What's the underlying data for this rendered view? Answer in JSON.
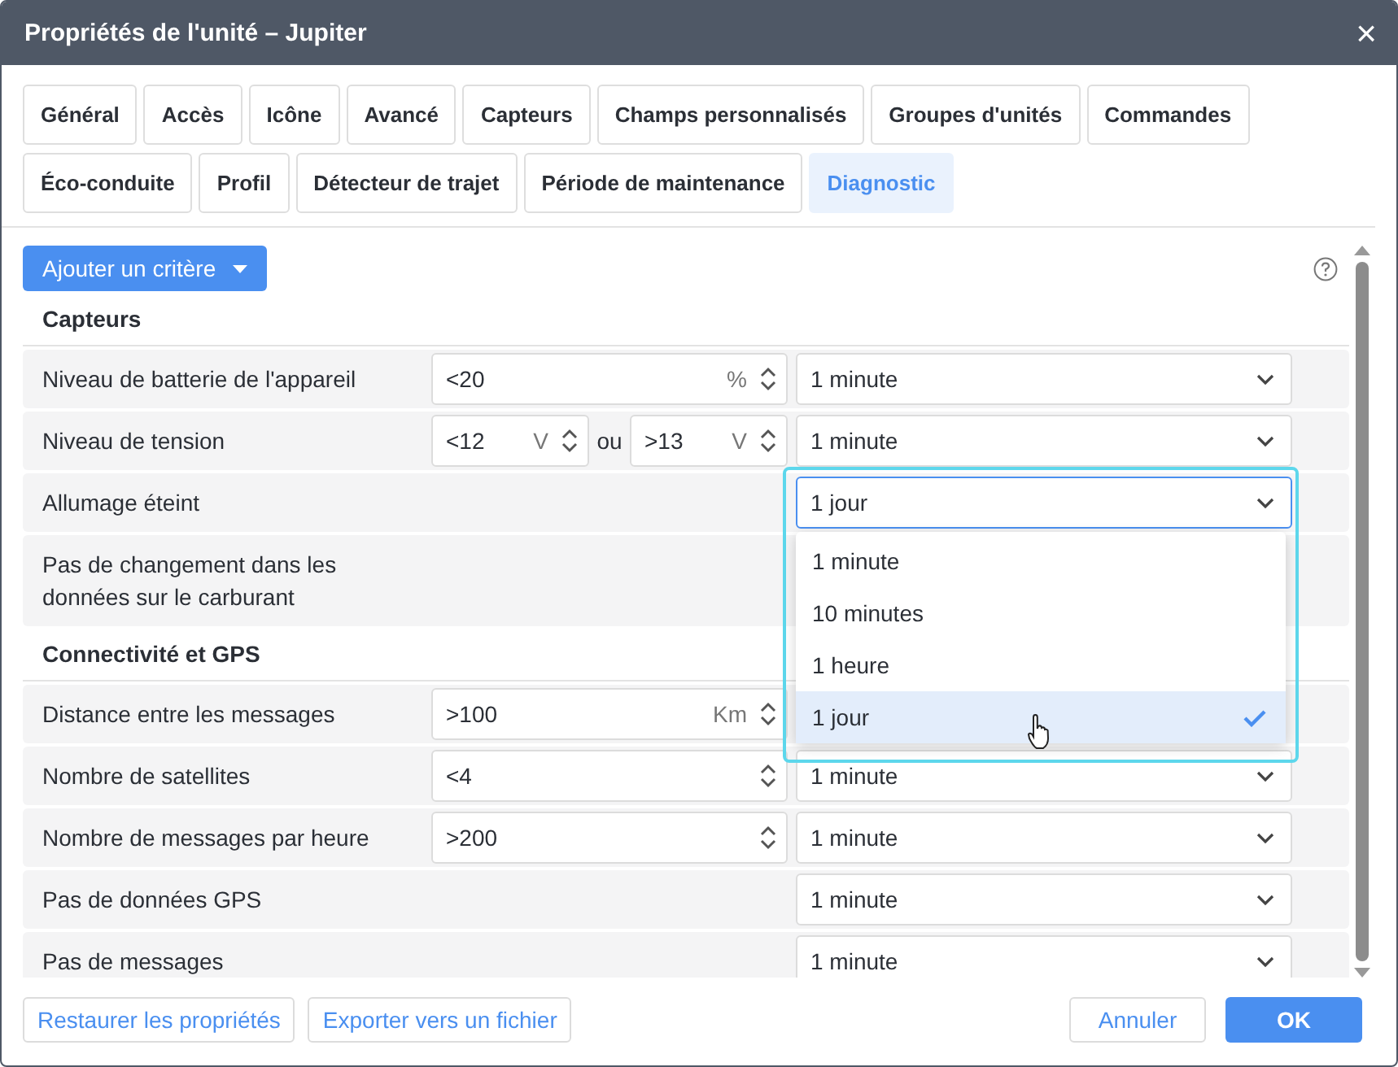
{
  "window": {
    "title": "Propriétés de l'unité – Jupiter",
    "close": "×"
  },
  "tabs": [
    {
      "label": "Général",
      "selected": false
    },
    {
      "label": "Accès",
      "selected": false
    },
    {
      "label": "Icône",
      "selected": false
    },
    {
      "label": "Avancé",
      "selected": false
    },
    {
      "label": "Capteurs",
      "selected": false
    },
    {
      "label": "Champs personnalisés",
      "selected": false
    },
    {
      "label": "Groupes d'unités",
      "selected": false
    },
    {
      "label": "Commandes",
      "selected": false
    },
    {
      "label": "Éco-conduite",
      "selected": false
    },
    {
      "label": "Profil",
      "selected": false
    },
    {
      "label": "Détecteur de trajet",
      "selected": false
    },
    {
      "label": "Période de maintenance",
      "selected": false
    },
    {
      "label": "Diagnostic",
      "selected": true
    }
  ],
  "add_button": {
    "label": "Ajouter un critère"
  },
  "sections": [
    {
      "title": "Capteurs",
      "rows": [
        {
          "label": "Niveau de batterie de l'appareil",
          "kind": "single",
          "inputs": [
            {
              "value": "<20",
              "unit": "%"
            }
          ],
          "select": {
            "value": "1 minute",
            "open": false
          }
        },
        {
          "label": "Niveau de tension",
          "kind": "range",
          "inputs": [
            {
              "value": "<12",
              "unit": "V"
            },
            {
              "value": ">13",
              "unit": "V"
            }
          ],
          "joiner": "ou",
          "select": {
            "value": "1 minute",
            "open": false
          }
        },
        {
          "label": "Allumage éteint",
          "kind": "none",
          "select": {
            "value": "1 jour",
            "open": true,
            "options": [
              {
                "label": "1 minute",
                "selected": false
              },
              {
                "label": "10 minutes",
                "selected": false
              },
              {
                "label": "1 heure",
                "selected": false
              },
              {
                "label": "1 jour",
                "selected": true
              }
            ]
          }
        },
        {
          "label": "Pas de changement dans les données sur le carburant",
          "kind": "none"
        }
      ]
    },
    {
      "title": "Connectivité et GPS",
      "rows": [
        {
          "label": "Distance entre les messages",
          "kind": "single",
          "inputs": [
            {
              "value": ">100",
              "unit": "Km"
            }
          ]
        },
        {
          "label": "Nombre de satellites",
          "kind": "single",
          "inputs": [
            {
              "value": "<4"
            }
          ],
          "select": {
            "value": "1 minute",
            "open": false
          }
        },
        {
          "label": "Nombre de messages par heure",
          "kind": "single",
          "inputs": [
            {
              "value": ">200"
            }
          ],
          "select": {
            "value": "1 minute",
            "open": false
          }
        },
        {
          "label": "Pas de données GPS",
          "kind": "none",
          "select": {
            "value": "1 minute",
            "open": false
          }
        },
        {
          "label": "Pas de messages",
          "kind": "none",
          "select": {
            "value": "1 minute",
            "open": false
          }
        }
      ]
    }
  ],
  "footer": {
    "left_buttons": [
      "Restaurer les propriétés",
      "Exporter vers un fichier"
    ],
    "cancel": "Annuler",
    "ok": "OK"
  }
}
